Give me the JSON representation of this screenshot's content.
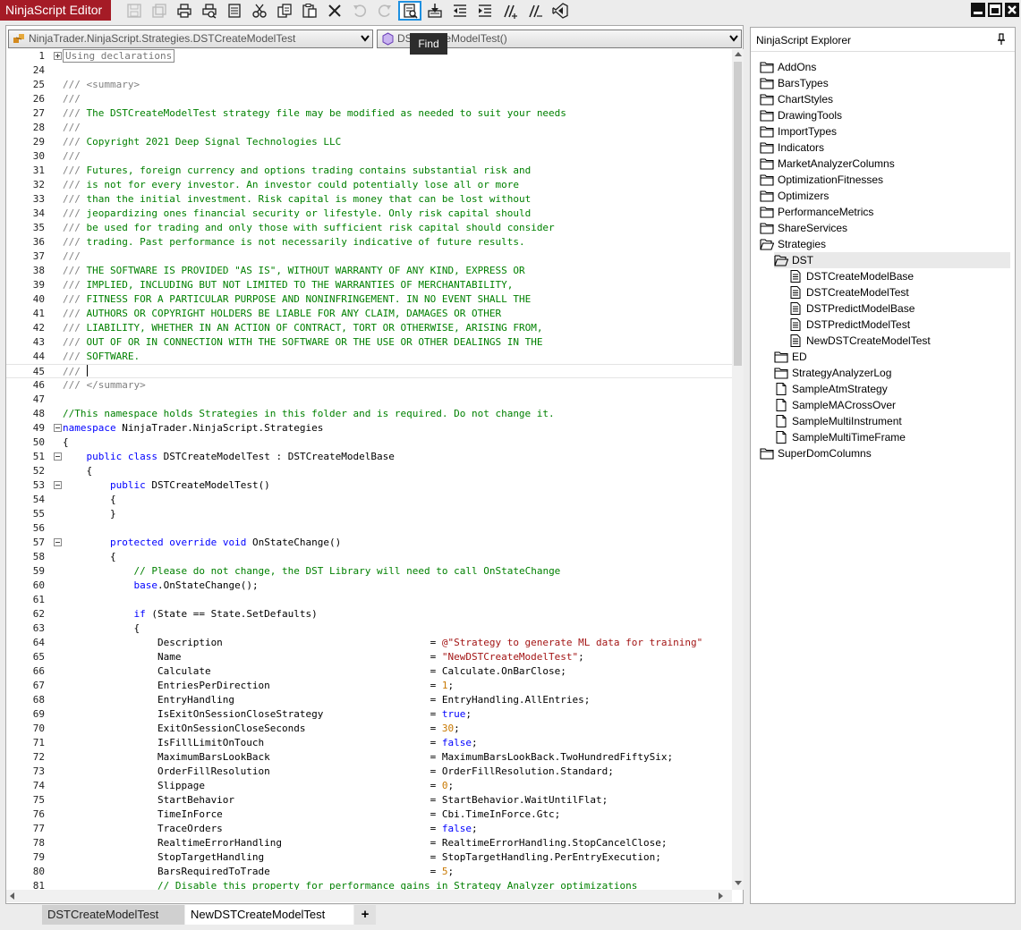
{
  "app": {
    "title": "NinjaScript Editor"
  },
  "toolbar": {
    "tooltip": "Find"
  },
  "editor": {
    "class_selector": "NinjaTrader.NinjaScript.Strategies.DSTCreateModelTest",
    "member_selector": "DSTCreateModelTest()"
  },
  "code_lines": [
    {
      "n": "1",
      "fold": "plus",
      "segs": [
        {
          "t": "Using declarations",
          "c": "coll"
        }
      ]
    },
    {
      "n": "24",
      "segs": []
    },
    {
      "n": "25",
      "segs": [
        {
          "t": "/// ",
          "c": "doc"
        },
        {
          "t": "<summary>",
          "c": "doc"
        }
      ]
    },
    {
      "n": "26",
      "segs": [
        {
          "t": "///",
          "c": "doc"
        }
      ]
    },
    {
      "n": "27",
      "segs": [
        {
          "t": "/// ",
          "c": "doc"
        },
        {
          "t": "The DSTCreateModelTest strategy file may be modified as needed to suit your needs",
          "c": "com"
        }
      ]
    },
    {
      "n": "28",
      "segs": [
        {
          "t": "///",
          "c": "doc"
        }
      ]
    },
    {
      "n": "29",
      "segs": [
        {
          "t": "/// ",
          "c": "doc"
        },
        {
          "t": "Copyright 2021 Deep Signal Technologies LLC",
          "c": "com"
        }
      ]
    },
    {
      "n": "30",
      "segs": [
        {
          "t": "///",
          "c": "doc"
        }
      ]
    },
    {
      "n": "31",
      "segs": [
        {
          "t": "/// ",
          "c": "doc"
        },
        {
          "t": "Futures, foreign currency and options trading contains substantial risk and",
          "c": "com"
        }
      ]
    },
    {
      "n": "32",
      "segs": [
        {
          "t": "/// ",
          "c": "doc"
        },
        {
          "t": "is not for every investor. An investor could potentially lose all or more",
          "c": "com"
        }
      ]
    },
    {
      "n": "33",
      "segs": [
        {
          "t": "/// ",
          "c": "doc"
        },
        {
          "t": "than the initial investment. Risk capital is money that can be lost without",
          "c": "com"
        }
      ]
    },
    {
      "n": "34",
      "segs": [
        {
          "t": "/// ",
          "c": "doc"
        },
        {
          "t": "jeopardizing ones financial security or lifestyle. Only risk capital should",
          "c": "com"
        }
      ]
    },
    {
      "n": "35",
      "segs": [
        {
          "t": "/// ",
          "c": "doc"
        },
        {
          "t": "be used for trading and only those with sufficient risk capital should consider",
          "c": "com"
        }
      ]
    },
    {
      "n": "36",
      "segs": [
        {
          "t": "/// ",
          "c": "doc"
        },
        {
          "t": "trading. Past performance is not necessarily indicative of future results.",
          "c": "com"
        }
      ]
    },
    {
      "n": "37",
      "segs": [
        {
          "t": "///",
          "c": "doc"
        }
      ]
    },
    {
      "n": "38",
      "segs": [
        {
          "t": "/// ",
          "c": "doc"
        },
        {
          "t": "THE SOFTWARE IS PROVIDED \"AS IS\", WITHOUT WARRANTY OF ANY KIND, EXPRESS OR",
          "c": "com"
        }
      ]
    },
    {
      "n": "39",
      "segs": [
        {
          "t": "/// ",
          "c": "doc"
        },
        {
          "t": "IMPLIED, INCLUDING BUT NOT LIMITED TO THE WARRANTIES OF MERCHANTABILITY,",
          "c": "com"
        }
      ]
    },
    {
      "n": "40",
      "segs": [
        {
          "t": "/// ",
          "c": "doc"
        },
        {
          "t": "FITNESS FOR A PARTICULAR PURPOSE AND NONINFRINGEMENT. IN NO EVENT SHALL THE",
          "c": "com"
        }
      ]
    },
    {
      "n": "41",
      "segs": [
        {
          "t": "/// ",
          "c": "doc"
        },
        {
          "t": "AUTHORS OR COPYRIGHT HOLDERS BE LIABLE FOR ANY CLAIM, DAMAGES OR OTHER",
          "c": "com"
        }
      ]
    },
    {
      "n": "42",
      "segs": [
        {
          "t": "/// ",
          "c": "doc"
        },
        {
          "t": "LIABILITY, WHETHER IN AN ACTION OF CONTRACT, TORT OR OTHERWISE, ARISING FROM,",
          "c": "com"
        }
      ]
    },
    {
      "n": "43",
      "segs": [
        {
          "t": "/// ",
          "c": "doc"
        },
        {
          "t": "OUT OF OR IN CONNECTION WITH THE SOFTWARE OR THE USE OR OTHER DEALINGS IN THE",
          "c": "com"
        }
      ]
    },
    {
      "n": "44",
      "segs": [
        {
          "t": "/// ",
          "c": "doc"
        },
        {
          "t": "SOFTWARE.",
          "c": "com"
        }
      ]
    },
    {
      "n": "45",
      "cursor": true,
      "segs": [
        {
          "t": "/// ",
          "c": "doc"
        }
      ]
    },
    {
      "n": "46",
      "segs": [
        {
          "t": "/// ",
          "c": "doc"
        },
        {
          "t": "</summary>",
          "c": "doc"
        }
      ]
    },
    {
      "n": "47",
      "segs": []
    },
    {
      "n": "48",
      "segs": [
        {
          "t": "//This namespace holds Strategies in this folder and is required. Do not change it.",
          "c": "com"
        }
      ]
    },
    {
      "n": "49",
      "fold": "minus",
      "segs": [
        {
          "t": "namespace",
          "c": "kw"
        },
        {
          "t": " NinjaTrader.NinjaScript.Strategies"
        }
      ]
    },
    {
      "n": "50",
      "segs": [
        {
          "t": "{"
        }
      ]
    },
    {
      "n": "51",
      "fold": "minus",
      "segs": [
        {
          "t": "    "
        },
        {
          "t": "public",
          "c": "kw"
        },
        {
          "t": " "
        },
        {
          "t": "class",
          "c": "kw"
        },
        {
          "t": " DSTCreateModelTest : DSTCreateModelBase"
        }
      ]
    },
    {
      "n": "52",
      "segs": [
        {
          "t": "    {"
        }
      ]
    },
    {
      "n": "53",
      "fold": "minus",
      "segs": [
        {
          "t": "        "
        },
        {
          "t": "public",
          "c": "kw"
        },
        {
          "t": " DSTCreateModelTest()"
        }
      ]
    },
    {
      "n": "54",
      "segs": [
        {
          "t": "        {"
        }
      ]
    },
    {
      "n": "55",
      "segs": [
        {
          "t": "        }"
        }
      ]
    },
    {
      "n": "56",
      "segs": []
    },
    {
      "n": "57",
      "fold": "minus",
      "segs": [
        {
          "t": "        "
        },
        {
          "t": "protected",
          "c": "kw"
        },
        {
          "t": " "
        },
        {
          "t": "override",
          "c": "kw"
        },
        {
          "t": " "
        },
        {
          "t": "void",
          "c": "kw"
        },
        {
          "t": " OnStateChange()"
        }
      ]
    },
    {
      "n": "58",
      "segs": [
        {
          "t": "        {"
        }
      ]
    },
    {
      "n": "59",
      "segs": [
        {
          "t": "            "
        },
        {
          "t": "// Please do not change, the DST Library will need to call OnStateChange",
          "c": "com"
        }
      ]
    },
    {
      "n": "60",
      "segs": [
        {
          "t": "            "
        },
        {
          "t": "base",
          "c": "kw"
        },
        {
          "t": ".OnStateChange();"
        }
      ]
    },
    {
      "n": "61",
      "segs": []
    },
    {
      "n": "62",
      "segs": [
        {
          "t": "            "
        },
        {
          "t": "if",
          "c": "kw"
        },
        {
          "t": " (State == State.SetDefaults)"
        }
      ]
    },
    {
      "n": "63",
      "segs": [
        {
          "t": "            {"
        }
      ]
    },
    {
      "n": "64",
      "segs": [
        {
          "t": "                Description                                   = "
        },
        {
          "t": "@\"Strategy to generate ML data for training\"",
          "c": "str"
        }
      ]
    },
    {
      "n": "65",
      "segs": [
        {
          "t": "                Name                                          = "
        },
        {
          "t": "\"NewDSTCreateModelTest\"",
          "c": "str"
        },
        {
          "t": ";"
        }
      ]
    },
    {
      "n": "66",
      "segs": [
        {
          "t": "                Calculate                                     = Calculate.OnBarClose;"
        }
      ]
    },
    {
      "n": "67",
      "segs": [
        {
          "t": "                EntriesPerDirection                           = "
        },
        {
          "t": "1",
          "c": "num"
        },
        {
          "t": ";"
        }
      ]
    },
    {
      "n": "68",
      "segs": [
        {
          "t": "                EntryHandling                                 = EntryHandling.AllEntries;"
        }
      ]
    },
    {
      "n": "69",
      "segs": [
        {
          "t": "                IsExitOnSessionCloseStrategy                  = "
        },
        {
          "t": "true",
          "c": "kw"
        },
        {
          "t": ";"
        }
      ]
    },
    {
      "n": "70",
      "segs": [
        {
          "t": "                ExitOnSessionCloseSeconds                     = "
        },
        {
          "t": "30",
          "c": "num"
        },
        {
          "t": ";"
        }
      ]
    },
    {
      "n": "71",
      "segs": [
        {
          "t": "                IsFillLimitOnTouch                            = "
        },
        {
          "t": "false",
          "c": "kw"
        },
        {
          "t": ";"
        }
      ]
    },
    {
      "n": "72",
      "segs": [
        {
          "t": "                MaximumBarsLookBack                           = MaximumBarsLookBack.TwoHundredFiftySix;"
        }
      ]
    },
    {
      "n": "73",
      "segs": [
        {
          "t": "                OrderFillResolution                           = OrderFillResolution.Standard;"
        }
      ]
    },
    {
      "n": "74",
      "segs": [
        {
          "t": "                Slippage                                      = "
        },
        {
          "t": "0",
          "c": "num"
        },
        {
          "t": ";"
        }
      ]
    },
    {
      "n": "75",
      "segs": [
        {
          "t": "                StartBehavior                                 = StartBehavior.WaitUntilFlat;"
        }
      ]
    },
    {
      "n": "76",
      "segs": [
        {
          "t": "                TimeInForce                                   = Cbi.TimeInForce.Gtc;"
        }
      ]
    },
    {
      "n": "77",
      "segs": [
        {
          "t": "                TraceOrders                                   = "
        },
        {
          "t": "false",
          "c": "kw"
        },
        {
          "t": ";"
        }
      ]
    },
    {
      "n": "78",
      "segs": [
        {
          "t": "                RealtimeErrorHandling                         = RealtimeErrorHandling.StopCancelClose;"
        }
      ]
    },
    {
      "n": "79",
      "segs": [
        {
          "t": "                StopTargetHandling                            = StopTargetHandling.PerEntryExecution;"
        }
      ]
    },
    {
      "n": "80",
      "segs": [
        {
          "t": "                BarsRequiredToTrade                           = "
        },
        {
          "t": "5",
          "c": "num"
        },
        {
          "t": ";"
        }
      ]
    },
    {
      "n": "81",
      "segs": [
        {
          "t": "                "
        },
        {
          "t": "// Disable this property for performance gains in Strategy Analyzer optimizations",
          "c": "com"
        }
      ]
    }
  ],
  "tabs": [
    {
      "label": "DSTCreateModelTest"
    },
    {
      "label": "NewDSTCreateModelTest"
    }
  ],
  "tab_add_label": "+",
  "explorer": {
    "title": "NinjaScript Explorer",
    "items": [
      {
        "label": "AddOns",
        "icon": "folder-icon",
        "level": 0
      },
      {
        "label": "BarsTypes",
        "icon": "folder-icon",
        "level": 0
      },
      {
        "label": "ChartStyles",
        "icon": "folder-icon",
        "level": 0
      },
      {
        "label": "DrawingTools",
        "icon": "folder-icon",
        "level": 0
      },
      {
        "label": "ImportTypes",
        "icon": "folder-icon",
        "level": 0
      },
      {
        "label": "Indicators",
        "icon": "folder-icon",
        "level": 0
      },
      {
        "label": "MarketAnalyzerColumns",
        "icon": "folder-icon",
        "level": 0
      },
      {
        "label": "OptimizationFitnesses",
        "icon": "folder-icon",
        "level": 0
      },
      {
        "label": "Optimizers",
        "icon": "folder-icon",
        "level": 0
      },
      {
        "label": "PerformanceMetrics",
        "icon": "folder-icon",
        "level": 0
      },
      {
        "label": "ShareServices",
        "icon": "folder-icon",
        "level": 0
      },
      {
        "label": "Strategies",
        "icon": "folder-open-icon",
        "level": 0
      },
      {
        "label": "DST",
        "icon": "folder-open-icon",
        "level": 1,
        "selected": true
      },
      {
        "label": "DSTCreateModelBase",
        "icon": "file-icon",
        "level": 2
      },
      {
        "label": "DSTCreateModelTest",
        "icon": "file-icon",
        "level": 2
      },
      {
        "label": "DSTPredictModelBase",
        "icon": "file-icon",
        "level": 2
      },
      {
        "label": "DSTPredictModelTest",
        "icon": "file-icon",
        "level": 2
      },
      {
        "label": "NewDSTCreateModelTest",
        "icon": "file-icon",
        "level": 2
      },
      {
        "label": "ED",
        "icon": "folder-icon",
        "level": 1
      },
      {
        "label": "StrategyAnalyzerLog",
        "icon": "folder-icon",
        "level": 1
      },
      {
        "label": "SampleAtmStrategy",
        "icon": "page-icon",
        "level": 1
      },
      {
        "label": "SampleMACrossOver",
        "icon": "page-icon",
        "level": 1
      },
      {
        "label": "SampleMultiInstrument",
        "icon": "page-icon",
        "level": 1
      },
      {
        "label": "SampleMultiTimeFrame",
        "icon": "page-icon",
        "level": 1
      },
      {
        "label": "SuperDomColumns",
        "icon": "folder-icon",
        "level": 0
      }
    ]
  }
}
